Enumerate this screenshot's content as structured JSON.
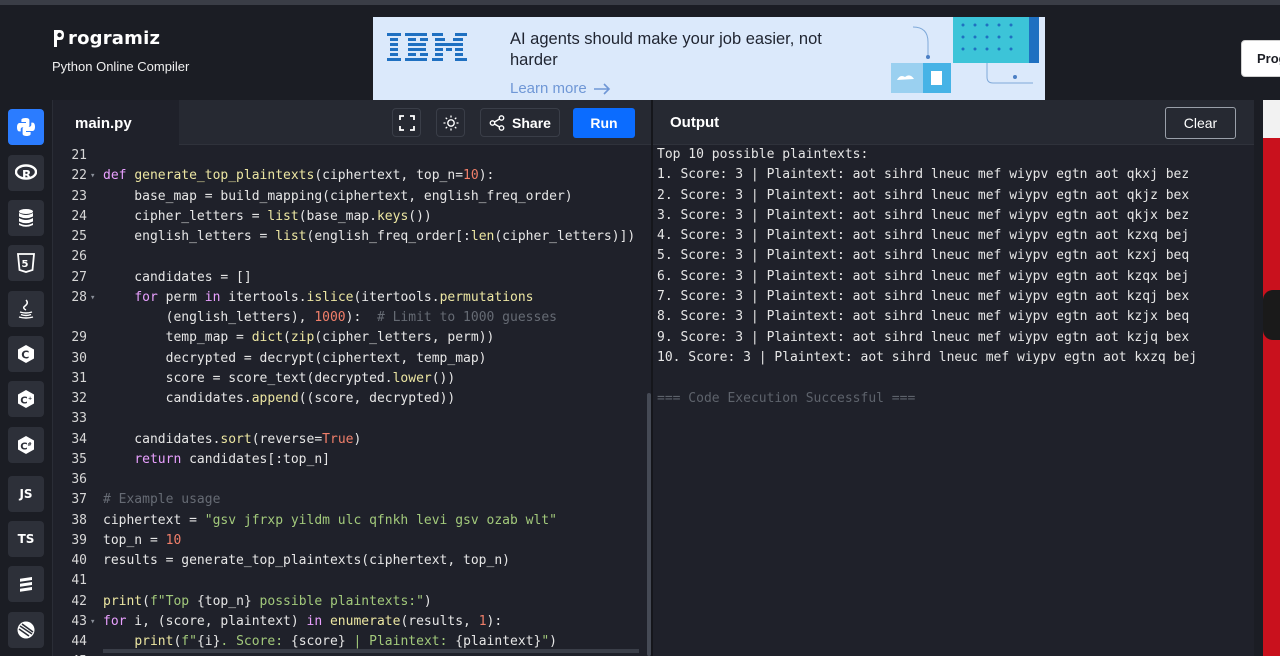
{
  "header": {
    "logo_text": "rogramiz",
    "tagline": "Python Online Compiler",
    "programiz_button": "Prog"
  },
  "ad": {
    "brand": "IBM",
    "headline": "AI agents should make your job easier, not harder",
    "link": "Learn more"
  },
  "sidebar": {
    "items": [
      {
        "icon": "python-icon",
        "label": ""
      },
      {
        "icon": "r-language-icon",
        "label": ""
      },
      {
        "icon": "database-icon",
        "label": ""
      },
      {
        "icon": "html5-icon",
        "label": ""
      },
      {
        "icon": "java-icon",
        "label": ""
      },
      {
        "icon": "c-icon",
        "label": ""
      },
      {
        "icon": "cpp-icon",
        "label": ""
      },
      {
        "icon": "csharp-icon",
        "label": ""
      },
      {
        "icon": "js-icon",
        "label": "JS"
      },
      {
        "icon": "ts-icon",
        "label": "TS"
      },
      {
        "icon": "swift-icon",
        "label": ""
      },
      {
        "icon": "go-icon",
        "label": ""
      }
    ]
  },
  "editor": {
    "file_tab": "main.py",
    "share_label": "Share",
    "run_label": "Run",
    "lines": [
      {
        "n": "21",
        "fold": false,
        "html": ""
      },
      {
        "n": "22",
        "fold": true,
        "html": "<span class=\"kw\">def</span> <span class=\"fn\">generate_top_plaintexts</span>(ciphertext, top_n=<span class=\"nm\">10</span>):"
      },
      {
        "n": "23",
        "fold": false,
        "html": "    base_map = build_mapping(ciphertext, english_freq_order)"
      },
      {
        "n": "24",
        "fold": false,
        "html": "    cipher_letters = <span class=\"fn\">list</span>(base_map.<span class=\"fn\">keys</span>())"
      },
      {
        "n": "25",
        "fold": false,
        "html": "    english_letters = <span class=\"fn\">list</span>(english_freq_order[:<span class=\"fn\">len</span>(cipher_letters)])"
      },
      {
        "n": "26",
        "fold": false,
        "html": ""
      },
      {
        "n": "27",
        "fold": false,
        "html": "    candidates = []"
      },
      {
        "n": "28",
        "fold": true,
        "html": "    <span class=\"kw\">for</span> perm <span class=\"kw\">in</span> itertools.<span class=\"fn\">islice</span>(itertools.<span class=\"fn\">permutations</span>"
      },
      {
        "n": "",
        "fold": false,
        "html": "        (english_letters), <span class=\"nm\">1000</span>):  <span class=\"cm\"># Limit to 1000 guesses</span>"
      },
      {
        "n": "29",
        "fold": false,
        "html": "        temp_map = <span class=\"fn\">dict</span>(<span class=\"fn\">zip</span>(cipher_letters, perm))"
      },
      {
        "n": "30",
        "fold": false,
        "html": "        decrypted = decrypt(ciphertext, temp_map)"
      },
      {
        "n": "31",
        "fold": false,
        "html": "        score = score_text(decrypted.<span class=\"fn\">lower</span>())"
      },
      {
        "n": "32",
        "fold": false,
        "html": "        candidates.<span class=\"fn\">append</span>((score, decrypted))"
      },
      {
        "n": "33",
        "fold": false,
        "html": ""
      },
      {
        "n": "34",
        "fold": false,
        "html": "    candidates.<span class=\"fn\">sort</span>(reverse=<span class=\"nm\">True</span>)"
      },
      {
        "n": "35",
        "fold": false,
        "html": "    <span class=\"kw\">return</span> candidates[:top_n]"
      },
      {
        "n": "36",
        "fold": false,
        "html": ""
      },
      {
        "n": "37",
        "fold": false,
        "html": "<span class=\"cm\"># Example usage</span>"
      },
      {
        "n": "38",
        "fold": false,
        "html": "ciphertext = <span class=\"st\">\"gsv jfrxp yildm ulc qfnkh levi gsv ozab wlt\"</span>"
      },
      {
        "n": "39",
        "fold": false,
        "html": "top_n = <span class=\"nm\">10</span>"
      },
      {
        "n": "40",
        "fold": false,
        "html": "results = generate_top_plaintexts(ciphertext, top_n)"
      },
      {
        "n": "41",
        "fold": false,
        "html": ""
      },
      {
        "n": "42",
        "fold": false,
        "html": "<span class=\"fn\">print</span>(<span class=\"st\">f\"Top </span>{top_n}<span class=\"st\"> possible plaintexts:\"</span>)"
      },
      {
        "n": "43",
        "fold": true,
        "html": "<span class=\"kw\">for</span> i, (score, plaintext) <span class=\"kw\">in</span> <span class=\"fn\">enumerate</span>(results, <span class=\"nm\">1</span>):"
      },
      {
        "n": "44",
        "fold": false,
        "html": "    <span class=\"fn\">print</span>(<span class=\"st\">f\"</span>{i}<span class=\"st\">. Score: </span>{score}<span class=\"st\"> | Plaintext: </span>{plaintext}<span class=\"st\">\"</span>)"
      },
      {
        "n": "45",
        "fold": false,
        "html": ""
      }
    ]
  },
  "output": {
    "title": "Output",
    "clear_label": "Clear",
    "lines": [
      "Top 10 possible plaintexts:",
      "1. Score: 3 | Plaintext: aot sihrd lneuc mef wiypv egtn aot qkxj bez",
      "2. Score: 3 | Plaintext: aot sihrd lneuc mef wiypv egtn aot qkjz bex",
      "3. Score: 3 | Plaintext: aot sihrd lneuc mef wiypv egtn aot qkjx bez",
      "4. Score: 3 | Plaintext: aot sihrd lneuc mef wiypv egtn aot kzxq bej",
      "5. Score: 3 | Plaintext: aot sihrd lneuc mef wiypv egtn aot kzxj beq",
      "6. Score: 3 | Plaintext: aot sihrd lneuc mef wiypv egtn aot kzqx bej",
      "7. Score: 3 | Plaintext: aot sihrd lneuc mef wiypv egtn aot kzqj bex",
      "8. Score: 3 | Plaintext: aot sihrd lneuc mef wiypv egtn aot kzjx beq",
      "9. Score: 3 | Plaintext: aot sihrd lneuc mef wiypv egtn aot kzjq bex",
      "10. Score: 3 | Plaintext: aot sihrd lneuc mef wiypv egtn aot kxzq bej",
      "",
      "=== Code Execution Successful ==="
    ]
  }
}
